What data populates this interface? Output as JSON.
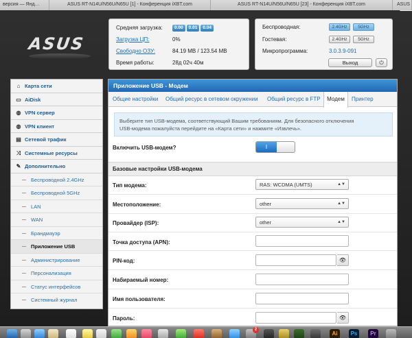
{
  "browser_tabs": [
    {
      "label": "версия — Янд…"
    },
    {
      "label": "ASUS RT-N14U/N56U/N65U [1] - Конференция iXBT.com"
    },
    {
      "label": "ASUS RT-N14U/N56U/N65U [23] - Конференция iXBT.com"
    },
    {
      "label": "ASUS"
    }
  ],
  "subtab": "Lo",
  "logo": "ASUS",
  "status_left": {
    "cpu_load_label": "Средняя загрузка:",
    "cpu_load_values": [
      "0.00",
      "0.01",
      "0.04"
    ],
    "cpu_usage_label": "Загрузка ЦП:",
    "cpu_usage_value": "0%",
    "free_ram_label": "Свободно ОЗУ:",
    "free_ram_value": "84.19 MB / 123.54 MB",
    "uptime_label": "Время работы:",
    "uptime_value": "28д 02ч 40м"
  },
  "status_right": {
    "wireless_label": "Беспроводная:",
    "wireless_bands": [
      "2.4GHz",
      "5GHz"
    ],
    "guest_label": "Гостевая:",
    "guest_bands": [
      "2.4GHz",
      "5GHz"
    ],
    "firmware_label": "Микропрограмма:",
    "firmware_value": "3.0.3.9-091",
    "exit_label": "Выход",
    "power_icon": "⏻"
  },
  "sidebar": {
    "items": [
      {
        "label": "Карта сети",
        "icon": "home-icon",
        "glyph": "⌂"
      },
      {
        "label": "AiDisk",
        "icon": "disk-icon",
        "glyph": "▭"
      },
      {
        "label": "VPN сервер",
        "icon": "globe-icon",
        "glyph": "◍"
      },
      {
        "label": "VPN клиент",
        "icon": "globe-icon",
        "glyph": "◍"
      },
      {
        "label": "Сетевой трафик",
        "icon": "traffic-icon",
        "glyph": "▤"
      },
      {
        "label": "Системные ресурсы",
        "icon": "shuffle-icon",
        "glyph": "⤨"
      },
      {
        "label": "Дополнительно",
        "icon": "wrench-icon",
        "glyph": "✎"
      }
    ],
    "subitems": [
      {
        "label": "Беспроводной 2.4GHz"
      },
      {
        "label": "Беспроводной 5GHz"
      },
      {
        "label": "LAN"
      },
      {
        "label": "WAN"
      },
      {
        "label": "Брандмауэр"
      },
      {
        "label": "Приложение USB",
        "active": true
      },
      {
        "label": "Администрирование"
      },
      {
        "label": "Персонализация"
      },
      {
        "label": "Статус интерфейсов"
      },
      {
        "label": "Системный журнал"
      }
    ]
  },
  "main": {
    "title": "Приложение USB - Модем",
    "tabs": [
      {
        "label": "Общие настройки"
      },
      {
        "label": "Общий ресурс в сетевом окружении"
      },
      {
        "label": "Общий ресурс в FTP"
      },
      {
        "label": "Модем",
        "active": true
      },
      {
        "label": "Принтер"
      }
    ],
    "notice_line1": "Выберите тип USB-модема, соответствующий Вашим требованиям. Для безопасного отключения",
    "notice_line2": "USB-модема пожалуйста перейдите на «Карта сети» и нажмите «Извлечь».",
    "enable_label": "Включить USB-модем?",
    "enable_toggle": "I",
    "section_title": "Базовые настройки USB-модема",
    "modem_type_label": "Тип модема:",
    "modem_type_value": "RAS: WCDMA (UMTS)",
    "location_label": "Местоположение:",
    "location_value": "other",
    "isp_label": "Провайдер (ISP):",
    "isp_value": "other",
    "apn_label": "Точка доступа (APN):",
    "pin_label": "PIN-код:",
    "dial_label": "Набираемый номер:",
    "user_label": "Имя пользователя:",
    "password_label": "Пароль:",
    "select_arrow": "▲▼",
    "eye_glyph": "👁"
  },
  "dock": {
    "badge": "2",
    "icons": [
      "Ai",
      "Ps",
      "Pr"
    ]
  }
}
